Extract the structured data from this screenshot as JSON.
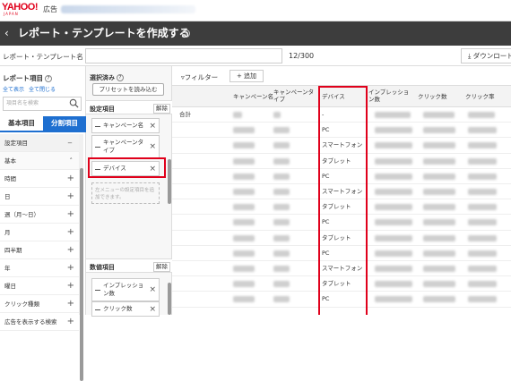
{
  "header": {
    "logo_text": "YAHOO!",
    "logo_sub": "JAPAN",
    "ad_tag": "広告"
  },
  "titlebar": {
    "back_icon": "chevron-left-icon",
    "title": "レポート・テンプレートを作成する"
  },
  "name_row": {
    "label": "レポート・テンプレート名",
    "counter": "12/300",
    "download_label": "ダウンロード"
  },
  "left_panel": {
    "heading": "レポート項目",
    "expand_all": "全て表示",
    "collapse_all": "全て閉じる",
    "search_placeholder": "項目名を検索",
    "tabs": [
      "基本項目",
      "分割項目"
    ],
    "items": [
      {
        "label": "設定項目",
        "kind": "section"
      },
      {
        "label": "基本",
        "kind": "sub"
      },
      {
        "label": "時間",
        "kind": "item"
      },
      {
        "label": "日",
        "kind": "item"
      },
      {
        "label": "週（月〜日）",
        "kind": "item"
      },
      {
        "label": "月",
        "kind": "item"
      },
      {
        "label": "四半期",
        "kind": "item"
      },
      {
        "label": "年",
        "kind": "item"
      },
      {
        "label": "曜日",
        "kind": "item"
      },
      {
        "label": "クリック種類",
        "kind": "item"
      },
      {
        "label": "広告を表示する検索",
        "kind": "item"
      }
    ]
  },
  "mid_panel": {
    "heading": "選択済み",
    "preset_button": "プリセットを読み込む",
    "settings_section": "設定項目",
    "clear_label": "解除",
    "settings_chips": [
      "キャンペーン名",
      "キャンペーンタイプ",
      "デバイス"
    ],
    "dropzone_text": "左メニューの設定項目を追加できます。",
    "metrics_section": "数値項目",
    "metrics_chips": [
      "インプレッション数",
      "クリック数"
    ]
  },
  "main": {
    "filter_label": "フィルター",
    "add_label": "追加",
    "columns": [
      "キャンペーン名",
      "キャンペーンタイプ",
      "デバイス",
      "インプレッション数",
      "クリック数",
      "クリック率"
    ],
    "total_label": "合計",
    "device_rows": [
      "-",
      "PC",
      "スマートフォン",
      "タブレット",
      "PC",
      "スマートフォン",
      "タブレット",
      "PC",
      "タブレット",
      "PC",
      "スマートフォン",
      "タブレット",
      "PC"
    ]
  }
}
